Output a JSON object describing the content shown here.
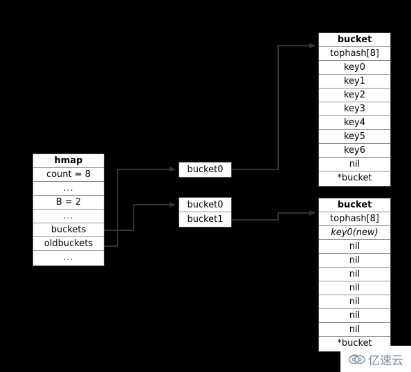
{
  "diagram": {
    "title": "Go map hmap / bucket growth diagram",
    "colors": {
      "background": "#000000",
      "box_fill": "#ffffff",
      "box_border": "#4d4d4d",
      "row_divider": "#8c8c8c",
      "edge": "#333333",
      "text": "#000000",
      "watermark_text": "#7a8a9a"
    }
  },
  "hmap": {
    "header": "hmap",
    "rows": [
      "hmap",
      "count = 8",
      "...",
      "B = 2",
      "...",
      "buckets",
      "oldbuckets",
      "..."
    ]
  },
  "buckets_pointer": {
    "rows": [
      "bucket0"
    ]
  },
  "oldbuckets_pointer": {
    "rows": [
      "bucket0",
      "bucket1"
    ]
  },
  "bucket_new": {
    "header": "bucket",
    "rows": [
      "bucket",
      "tophash[8]",
      "key0",
      "key1",
      "key2",
      "key3",
      "key4",
      "key5",
      "key6",
      "nil",
      "*bucket"
    ]
  },
  "bucket_old": {
    "header": "bucket",
    "rows": [
      "bucket",
      "tophash[8]",
      "key0(new)",
      "nil",
      "nil",
      "nil",
      "nil",
      "nil",
      "nil",
      "nil",
      "*bucket"
    ]
  },
  "watermark": {
    "text": "亿速云",
    "icon": "cloud-icon"
  }
}
